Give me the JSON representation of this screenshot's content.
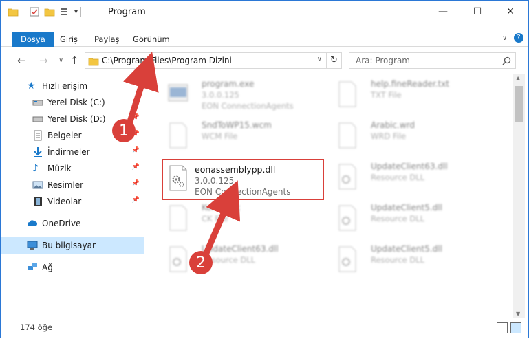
{
  "window": {
    "title": "Program",
    "minimize": "—",
    "maximize": "☐",
    "close": "✕"
  },
  "ribbon": {
    "tabs": [
      "Dosya",
      "Giriş",
      "Paylaş",
      "Görünüm"
    ]
  },
  "address": {
    "path": "C:\\Program Files\\Program Dizini"
  },
  "search": {
    "placeholder": "Ara: Program"
  },
  "sidebar": {
    "quick_access": "Hızlı erişim",
    "items": [
      "Yerel Disk (C:)",
      "Yerel Disk (D:)",
      "Belgeler",
      "İndirmeler",
      "Müzik",
      "Resimler",
      "Videolar"
    ],
    "onedrive": "OneDrive",
    "thispc": "Bu bilgisayar",
    "network": "Ağ"
  },
  "files": [
    {
      "name": "program.exe",
      "line2": "3.0.0.125",
      "line3": "EON ConnectionAgents"
    },
    {
      "name": "help.fineReader.txt",
      "line2": "TXT File",
      "line3": ""
    },
    {
      "name": "SndToWP15.wcm",
      "line2": "WCM File",
      "line3": ""
    },
    {
      "name": "Arabic.wrd",
      "line2": "WRD File",
      "line3": ""
    },
    {
      "name": "UpdateClient63.dll",
      "line2": "Resource DLL",
      "line3": ""
    },
    {
      "name": "Kompletk",
      "line2": "CK File",
      "line3": ""
    },
    {
      "name": "UpdateClient5.dll",
      "line2": "Resource DLL",
      "line3": ""
    },
    {
      "name": "UpdateClient63.dll",
      "line2": "Resource DLL",
      "line3": ""
    },
    {
      "name": "UpdateClient5.dll",
      "line2": "Resource DLL",
      "line3": ""
    }
  ],
  "highlighted": {
    "name": "eonassemblypp.dll",
    "version": "3.0.0.125",
    "company": "EON ConnectionAgents"
  },
  "status": {
    "count": "174 öğe"
  },
  "callouts": {
    "one": "1",
    "two": "2"
  },
  "colors": {
    "accent": "#1979ca",
    "callout": "#d9403a",
    "selection": "#cce8ff"
  }
}
